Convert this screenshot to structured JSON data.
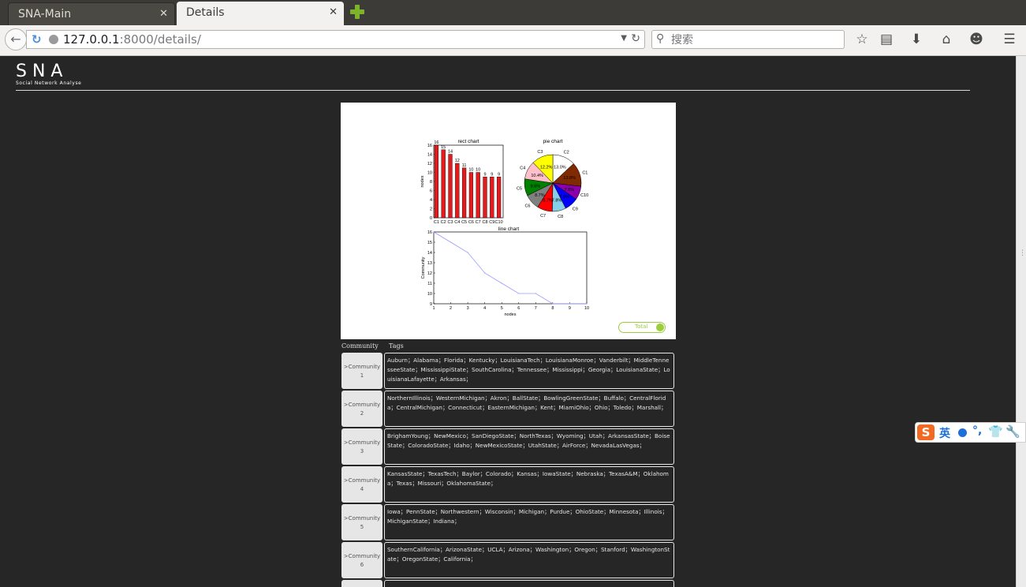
{
  "browser": {
    "tabs": [
      {
        "label": "SNA-Main",
        "active": false
      },
      {
        "label": "Details",
        "active": true
      }
    ],
    "url_host": "127.0.0.1",
    "url_rest": ":8000/details/",
    "search_placeholder": "搜索"
  },
  "header": {
    "logo_title": "SNA",
    "logo_subtitle": "Social Network Analyse"
  },
  "chart_data": [
    {
      "type": "bar",
      "title": "rect chart",
      "ylabel": "nodes",
      "xlabel": "",
      "categories": [
        "C1",
        "C2",
        "C3",
        "C4",
        "C5",
        "C6",
        "C7",
        "C8",
        "C9",
        "C10"
      ],
      "values": [
        16,
        15,
        14,
        12,
        11,
        10,
        10,
        9,
        9,
        9
      ],
      "ylim": [
        0,
        16
      ],
      "yticks": [
        0,
        2,
        4,
        6,
        8,
        10,
        12,
        14,
        16
      ],
      "color": "#e41a1c"
    },
    {
      "type": "pie",
      "title": "pie chart",
      "labels": [
        "C1",
        "C2",
        "C3",
        "C4",
        "C5",
        "C6",
        "C7",
        "C8",
        "C9",
        "C10"
      ],
      "values": [
        13.8,
        13.0,
        12.2,
        10.4,
        9.6,
        8.7,
        8.7,
        7.8,
        7.8,
        7.8
      ],
      "value_labels": [
        "13.8%",
        "13.0%",
        "12.2%",
        "10.4%",
        "9.6%",
        "8.7%",
        "8.7%",
        "7.8%",
        "7.8%",
        "7.8%"
      ],
      "colors": [
        "#7f2a00",
        "#ffffff",
        "#ffff00",
        "#ffc0cb",
        "#008000",
        "#808080",
        "#ff0000",
        "#87ceeb",
        "#0000ff",
        "#8b00a8"
      ]
    },
    {
      "type": "line",
      "title": "line chart",
      "xlabel": "nodes",
      "ylabel": "Community",
      "x": [
        1,
        2,
        3,
        4,
        5,
        6,
        7,
        8,
        9,
        10
      ],
      "y": [
        16,
        15,
        14,
        12,
        11,
        10,
        10,
        9,
        9,
        9
      ],
      "xlim": [
        1,
        10
      ],
      "ylim": [
        9,
        16
      ],
      "xticks": [
        1,
        2,
        3,
        4,
        5,
        6,
        7,
        8,
        9,
        10
      ],
      "yticks": [
        9,
        10,
        11,
        12,
        13,
        14,
        15,
        16
      ],
      "color": "#9a9aff"
    }
  ],
  "toggle_label": "Total",
  "table": {
    "headers": [
      "Community",
      "Tags"
    ],
    "rows": [
      {
        "label": ">Community 1",
        "tags": "Auburn；Alabama；Florida；Kentucky；LouisianaTech；LouisianaMonroe；Vanderbilt；MiddleTennesseeState；MississippiState；SouthCarolina；Tennessee；Mississippi；Georgia；LouisianaState；LouisianaLafayette；Arkansas；"
      },
      {
        "label": ">Community 2",
        "tags": "NorthernIllinois；WesternMichigan；Akron；BallState；BowlingGreenState；Buffalo；CentralFlorida；CentralMichigan；Connecticut；EasternMichigan；Kent；MiamiOhio；Ohio；Toledo；Marshall；"
      },
      {
        "label": ">Community 3",
        "tags": "BrighamYoung；NewMexico；SanDiegoState；NorthTexas；Wyoming；Utah；ArkansasState；BoiseState；ColoradoState；Idaho；NewMexicoState；UtahState；AirForce；NevadaLasVegas；"
      },
      {
        "label": ">Community 4",
        "tags": "KansasState；TexasTech；Baylor；Colorado；Kansas；IowaState；Nebraska；TexasA&M；Oklahoma；Texas；Missouri；OklahomaState；"
      },
      {
        "label": ">Community 5",
        "tags": "Iowa；PennState；Northwestern；Wisconsin；Michigan；Purdue；OhioState；Minnesota；Illinois；MichiganState；Indiana；"
      },
      {
        "label": ">Community 6",
        "tags": "SouthernCalifornia；ArizonaState；UCLA；Arizona；Washington；Oregon；Stanford；WashingtonState；OregonState；California；"
      }
    ]
  },
  "ime": {
    "logo": "S",
    "lang": "英"
  }
}
